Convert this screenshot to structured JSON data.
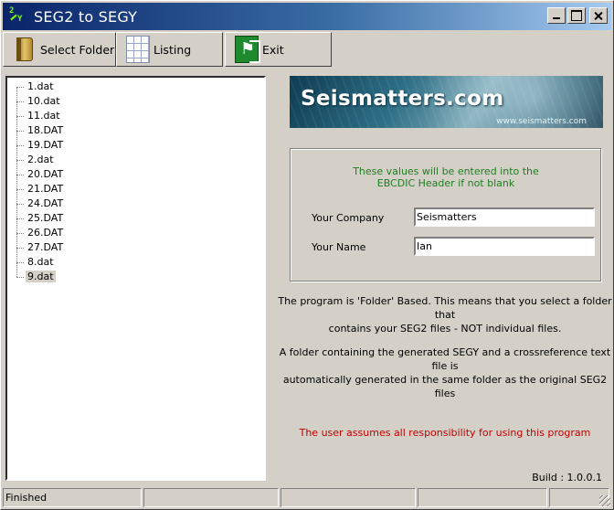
{
  "window": {
    "title": "SEG2 to SEGY",
    "icon": "seg2-app-icon"
  },
  "toolbar": {
    "select_folder": "Select Folder",
    "listing": "Listing",
    "exit": "Exit",
    "icons": [
      "book-folder-icon",
      "grid-icon",
      "exit-door-icon"
    ]
  },
  "files": [
    "1.dat",
    "10.dat",
    "11.dat",
    "18.DAT",
    "19.DAT",
    "2.dat",
    "20.DAT",
    "21.DAT",
    "24.DAT",
    "25.DAT",
    "26.DAT",
    "27.DAT",
    "8.dat",
    "9.dat"
  ],
  "selected_file": "9.dat",
  "banner": {
    "title": "Seismatters.com",
    "url": "www.seismatters.com"
  },
  "header": {
    "note_line1": "These values will be entered into the",
    "note_line2": "EBCDIC Header if not blank",
    "company_label": "Your Company",
    "company_value": "Seismatters",
    "name_label": "Your Name",
    "name_value": "Ian"
  },
  "info": {
    "folder_line1": "The program is 'Folder' Based. This means that you select a folder that",
    "folder_line2": "contains your SEG2 files - NOT individual files.",
    "output_line1": "A folder containing the generated SEGY and a crossreference text file is",
    "output_line2": "automatically generated in the same folder as the original SEG2 files",
    "warning": "The user assumes all responsibility for using this program",
    "build": "Build : 1.0.0.1"
  },
  "status": {
    "text": "Finished",
    "panel2": "",
    "panel3": "",
    "panel4": "",
    "panel5": ""
  },
  "colors": {
    "title_bar": "#0a246a",
    "note_text": "#1f7f1f",
    "warning_text": "#c00000",
    "face": "#d4d0c8"
  }
}
